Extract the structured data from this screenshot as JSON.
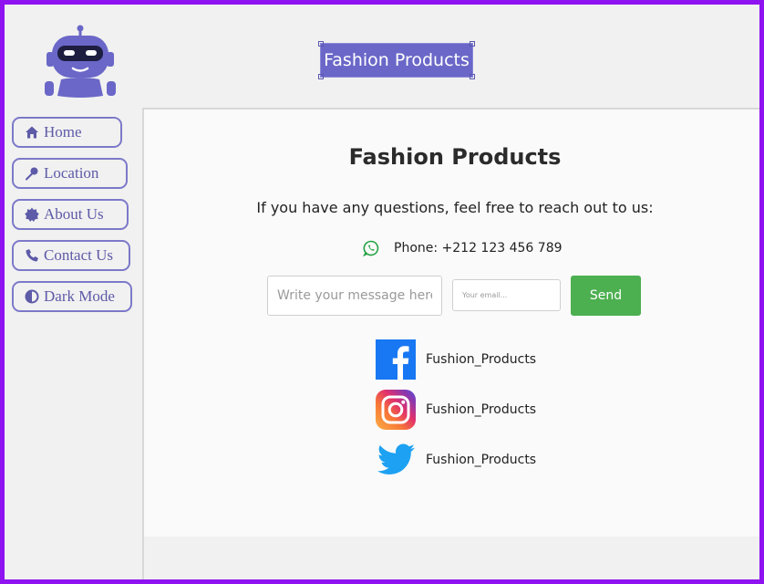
{
  "header": {
    "logo_icon": "robot-icon",
    "title": "Fashion Products"
  },
  "sidebar": {
    "items": [
      {
        "label": "Home",
        "icon": "home-icon"
      },
      {
        "label": "Location",
        "icon": "location-pin-icon"
      },
      {
        "label": "About Us",
        "icon": "badge-icon"
      },
      {
        "label": "Contact Us",
        "icon": "phone-icon"
      },
      {
        "label": "Dark Mode",
        "icon": "half-circle-icon"
      }
    ]
  },
  "main": {
    "title": "Fashion Products",
    "intro": "If you have any questions, feel free to reach out to us:",
    "phone": {
      "icon": "whatsapp-icon",
      "text": "Phone: +212 123 456 789"
    },
    "form": {
      "message_placeholder": "Write your message here...",
      "email_placeholder": "Your email...",
      "send_label": "Send"
    },
    "socials": [
      {
        "icon": "facebook-icon",
        "handle": "Fushion_Products"
      },
      {
        "icon": "instagram-icon",
        "handle": "Fushion_Products"
      },
      {
        "icon": "twitter-icon",
        "handle": "Fushion_Products"
      }
    ]
  },
  "colors": {
    "frame_border": "#8f12f0",
    "accent": "#6a67c8",
    "send_button": "#4caf50",
    "facebook": "#1877f2",
    "twitter": "#1da1f2",
    "whatsapp": "#25a244"
  }
}
